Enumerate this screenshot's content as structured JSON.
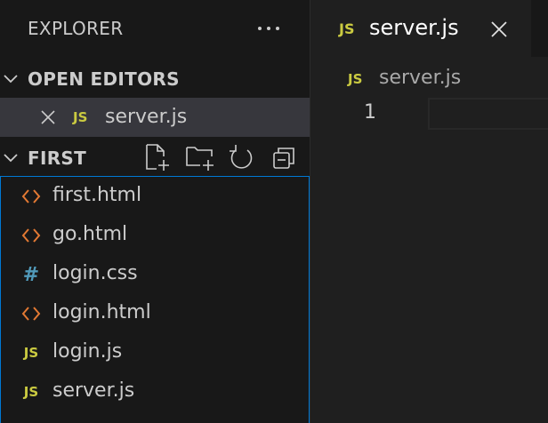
{
  "sidebar": {
    "title": "EXPLORER",
    "more_icon": "ellipsis-icon",
    "open_editors": {
      "label": "OPEN EDITORS",
      "items": [
        {
          "name": "server.js",
          "icon": "js-file-icon",
          "badge": "JS"
        }
      ]
    },
    "folder": {
      "label": "FIRST",
      "actions": [
        "new-file-icon",
        "new-folder-icon",
        "refresh-icon",
        "collapse-all-icon"
      ],
      "files": [
        {
          "name": "first.html",
          "icon": "html-file-icon",
          "glyph": "<>"
        },
        {
          "name": "go.html",
          "icon": "html-file-icon",
          "glyph": "<>"
        },
        {
          "name": "login.css",
          "icon": "css-file-icon",
          "glyph": "#"
        },
        {
          "name": "login.html",
          "icon": "html-file-icon",
          "glyph": "<>"
        },
        {
          "name": "login.js",
          "icon": "js-file-icon",
          "glyph": "JS"
        },
        {
          "name": "server.js",
          "icon": "js-file-icon",
          "glyph": "JS"
        }
      ]
    }
  },
  "editor": {
    "tab": {
      "name": "server.js",
      "badge": "JS"
    },
    "breadcrumb": {
      "name": "server.js",
      "badge": "JS"
    },
    "line_numbers": [
      "1"
    ]
  },
  "colors": {
    "sidebar_bg": "#181818",
    "editor_bg": "#1f1f1f",
    "selected_row": "#37373d",
    "focus_border": "#0078d4",
    "js_yellow": "#cbcb41",
    "html_orange": "#e37933",
    "css_blue": "#519aba",
    "text": "#cccccc"
  }
}
